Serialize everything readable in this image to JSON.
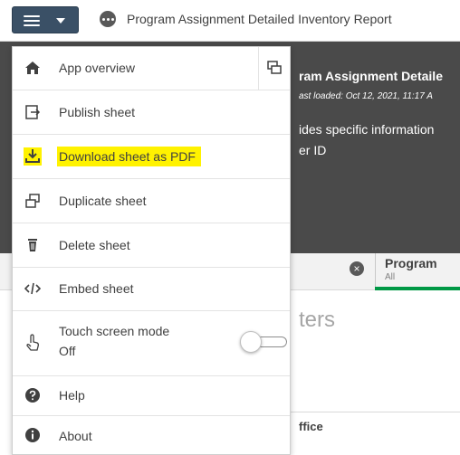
{
  "toolbar": {
    "menu_button_icon": "hamburger-icon",
    "app_icon": "more-dots-icon",
    "app_title": "Program Assignment Detailed Inventory Report"
  },
  "sheet_header": {
    "title": "ram Assignment Detaile",
    "last_loaded": "ast loaded: Oct 12, 2021, 11:17 A",
    "description_line1": "ides specific information",
    "description_line2": "er ID"
  },
  "filter_bar": {
    "clear_icon": "clear-circle-icon",
    "field_name": "Program",
    "field_value": "All",
    "selection_color": "#009845"
  },
  "background": {
    "filters_word": "ters",
    "office_header": "ffice"
  },
  "menu": {
    "items": [
      {
        "label": "App overview",
        "icon": "home-icon",
        "side_icon": "open-new-tab-icon"
      },
      {
        "label": "Publish sheet",
        "icon": "publish-icon"
      },
      {
        "label": "Download sheet as PDF",
        "icon": "download-icon",
        "highlighted": true,
        "highlight_color": "#fff200"
      },
      {
        "label": "Duplicate sheet",
        "icon": "duplicate-icon"
      },
      {
        "label": "Delete sheet",
        "icon": "trash-icon"
      },
      {
        "label": "Embed sheet",
        "icon": "code-icon"
      },
      {
        "label": "Touch screen mode",
        "sub_label": "Off",
        "icon": "touch-icon",
        "toggle": false
      },
      {
        "label": "Help",
        "icon": "help-icon"
      },
      {
        "label": "About",
        "icon": "info-icon"
      }
    ]
  },
  "colors": {
    "menu_button_bg": "#3a5066",
    "header_bg": "#4a4a4a"
  }
}
